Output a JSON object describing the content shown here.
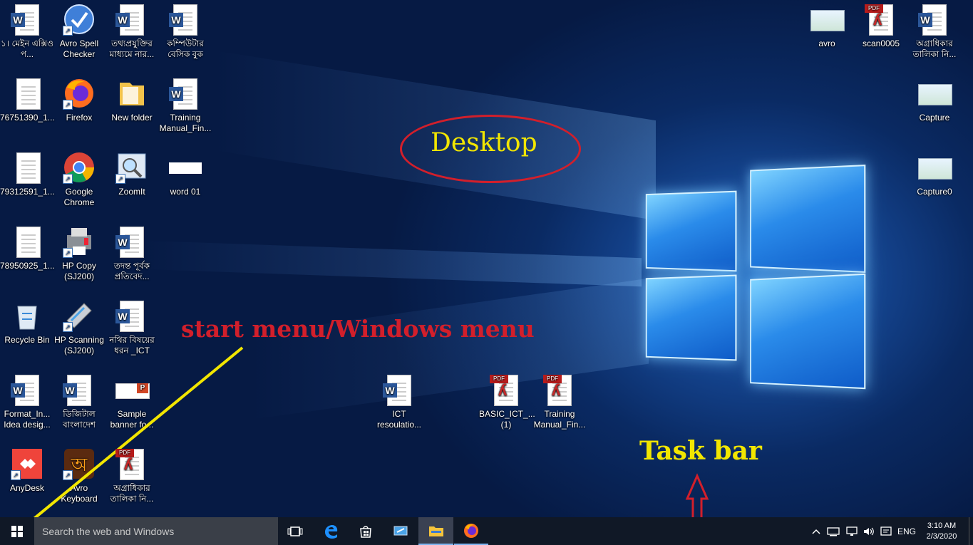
{
  "desktop": {
    "icons": [
      {
        "label": "১। মেইন এক্সিও প...",
        "kind": "word-doc"
      },
      {
        "label": "Avro Spell Checker",
        "kind": "avro-spell"
      },
      {
        "label": "তথ্যপ্রযুক্তির মাধ্যমে নার...",
        "kind": "word-doc"
      },
      {
        "label": "কম্পিউটার বেসিক বুক",
        "kind": "word-doc"
      },
      {
        "label": "76751390_1...",
        "kind": "scan-image"
      },
      {
        "label": "Firefox",
        "kind": "firefox"
      },
      {
        "label": "New folder",
        "kind": "folder"
      },
      {
        "label": "Training Manual_Fin...",
        "kind": "word-doc"
      },
      {
        "label": "79312591_1...",
        "kind": "scan-image"
      },
      {
        "label": "Google Chrome",
        "kind": "chrome"
      },
      {
        "label": "ZoomIt",
        "kind": "zoomit"
      },
      {
        "label": "word 01",
        "kind": "blank-image"
      },
      {
        "label": "78950925_1...",
        "kind": "scan-image"
      },
      {
        "label": "HP Copy (SJ200)",
        "kind": "printer"
      },
      {
        "label": "তদন্ত পূর্বক প্রতিবেদ...",
        "kind": "word-doc"
      },
      {
        "label": "Recycle Bin",
        "kind": "recycle-bin"
      },
      {
        "label": "HP Scanning (SJ200)",
        "kind": "scanner"
      },
      {
        "label": "নথির বিষয়ের ধরন _ICT",
        "kind": "word-doc"
      },
      {
        "label": "Format_In... Idea desig...",
        "kind": "word-doc"
      },
      {
        "label": "ডিজিটাল বাংলাদেশ",
        "kind": "word-doc"
      },
      {
        "label": "Sample banner fo...",
        "kind": "ppt"
      },
      {
        "label": "AnyDesk",
        "kind": "anydesk"
      },
      {
        "label": "Avro Keyboard",
        "kind": "avro-keyboard"
      },
      {
        "label": "অগ্রাধিকার তালিকা নি...",
        "kind": "pdf"
      },
      {
        "label": "ICT resoulatio...",
        "kind": "word-doc"
      },
      {
        "label": "BASIC_ICT_... (1)",
        "kind": "pdf"
      },
      {
        "label": "Training Manual_Fin...",
        "kind": "pdf"
      },
      {
        "label": "avro",
        "kind": "screenshot-image"
      },
      {
        "label": "scan0005",
        "kind": "pdf"
      },
      {
        "label": "অগ্রাধিকার তালিকা নি...",
        "kind": "word-doc"
      },
      {
        "label": "Capture",
        "kind": "screenshot-image"
      },
      {
        "label": "Capture0",
        "kind": "screenshot-image"
      }
    ],
    "annotations": {
      "desktop_label": "Desktop",
      "start_label": "start menu/Windows menu",
      "taskbar_label": "Task bar",
      "colors": {
        "red": "#d21f2b",
        "yellow": "#f2e600"
      }
    }
  },
  "taskbar": {
    "search_placeholder": "Search the web and Windows",
    "pinned": [
      "task-view-icon",
      "edge-icon",
      "store-icon",
      "remote-desktop-icon",
      "file-explorer-icon",
      "firefox-icon"
    ],
    "tray": {
      "language": "ENG",
      "time": "3:10 AM",
      "date": "2/3/2020"
    }
  }
}
